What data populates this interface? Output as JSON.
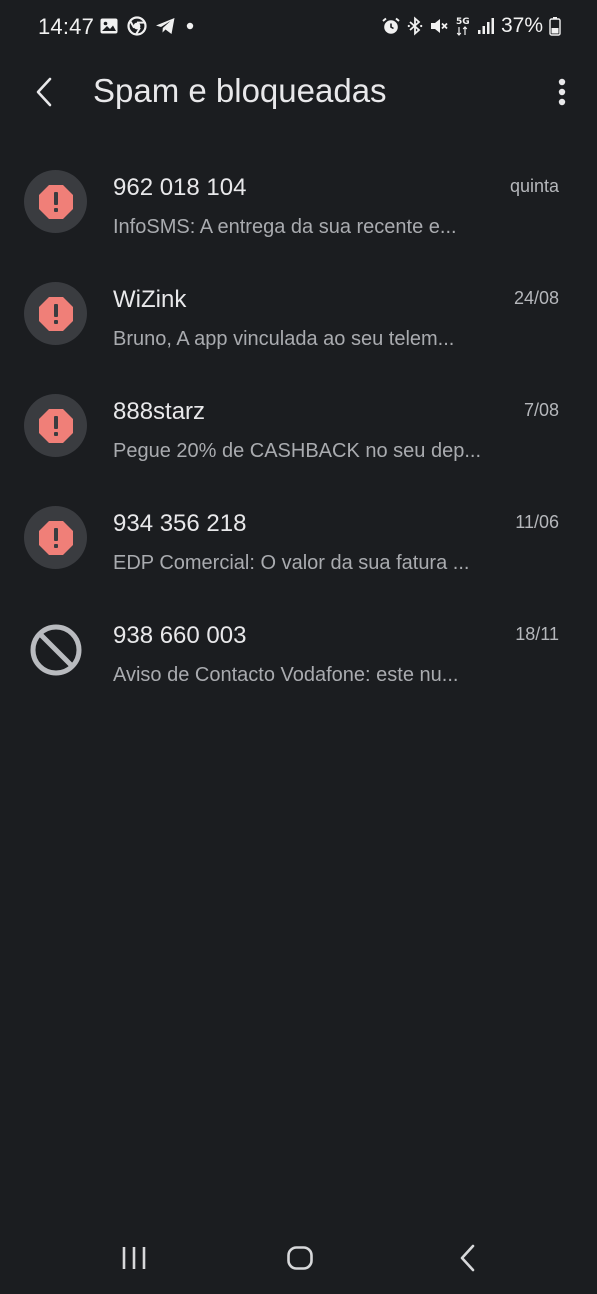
{
  "status_bar": {
    "time": "14:47",
    "battery": "37%",
    "left_icons": [
      "gallery-icon",
      "chrome-icon",
      "telegram-icon",
      "dot-icon"
    ],
    "right_icons": [
      "alarm-icon",
      "bluetooth-icon",
      "mute-icon",
      "5g-icon",
      "signal-icon",
      "battery-icon"
    ]
  },
  "app_bar": {
    "title": "Spam e bloqueadas",
    "back_icon": "back-arrow-icon",
    "menu_icon": "more-vert-icon"
  },
  "conversations": [
    {
      "sender": "962 018 104",
      "date": "quinta",
      "preview": "InfoSMS: A entrega da sua recente e...",
      "avatar_icon": "spam-warning-icon"
    },
    {
      "sender": "WiZink",
      "date": "24/08",
      "preview": "Bruno, A app vinculada ao seu telem...",
      "avatar_icon": "spam-warning-icon"
    },
    {
      "sender": "888starz",
      "date": "7/08",
      "preview": "Pegue 20% de CASHBACK no seu dep...",
      "avatar_icon": "spam-warning-icon"
    },
    {
      "sender": "934 356 218",
      "date": "11/06",
      "preview": "EDP Comercial: O valor da sua fatura ...",
      "avatar_icon": "spam-warning-icon"
    },
    {
      "sender": "938 660 003",
      "date": "18/11",
      "preview": "Aviso de Contacto Vodafone: este nu...",
      "avatar_icon": "blocked-icon"
    }
  ],
  "nav_bar": {
    "recents_icon": "recents-icon",
    "home_icon": "home-icon",
    "back_icon": "nav-back-icon"
  },
  "colors": {
    "background": "#1b1d20",
    "spam_icon": "#f07f78",
    "avatar_bg": "#3a3c40",
    "blocked_icon": "#b9bbbf",
    "primary_text": "#e8e8ea",
    "secondary_text": "#a9abaf"
  }
}
